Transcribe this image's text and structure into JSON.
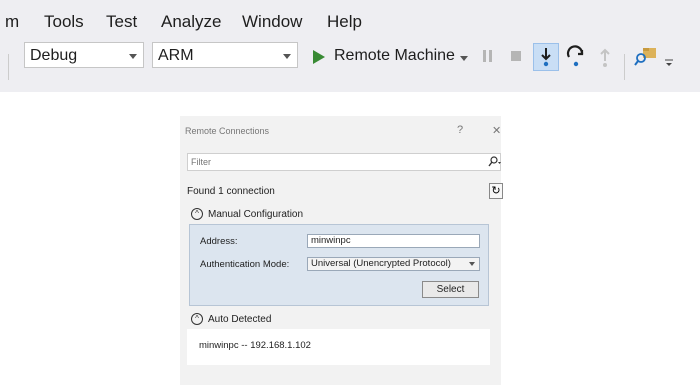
{
  "menu": {
    "items": [
      "m",
      "Tools",
      "Test",
      "Analyze",
      "Window",
      "Help"
    ]
  },
  "toolbar": {
    "configuration": "Debug",
    "platform": "ARM",
    "run_target": "Remote Machine"
  },
  "dialog": {
    "title": "Remote Connections",
    "help": "?",
    "close": "✕",
    "filter_placeholder": "Filter",
    "found_text": "Found 1 connection",
    "manual": {
      "title": "Manual Configuration",
      "address_label": "Address:",
      "address_value": "minwinpc",
      "auth_label": "Authentication Mode:",
      "auth_value": "Universal (Unencrypted Protocol)",
      "select_button": "Select"
    },
    "auto": {
      "title": "Auto Detected",
      "items": [
        "minwinpc -- 192.168.1.102"
      ]
    }
  },
  "colors": {
    "chrome_bg": "#eeeef2",
    "panel_bg": "#dce5ef",
    "run_green": "#388a34",
    "accent_blue": "#1e6fc0"
  }
}
